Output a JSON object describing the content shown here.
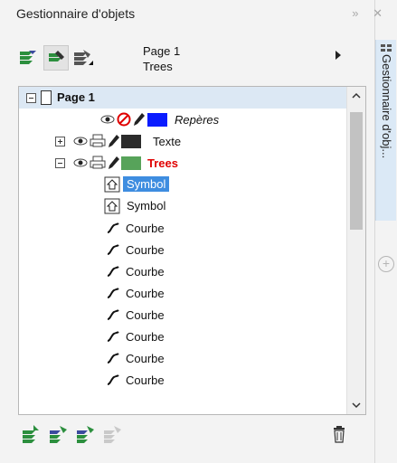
{
  "window": {
    "title": "Gestionnaire d'objets"
  },
  "titlebar_icons": {
    "collapse": "»",
    "close": "✕"
  },
  "toolbar": {
    "page_name": "Page 1",
    "layer_name": "Trees"
  },
  "tree": {
    "page": {
      "label": "Page 1"
    },
    "layers": [
      {
        "label": "Repères",
        "color": "#0a1cff"
      },
      {
        "label": "Texte",
        "color": "#2b2b2b"
      },
      {
        "label": "Trees",
        "color": "#57a35a",
        "label_color": "#e00000"
      }
    ],
    "symbols": [
      {
        "label": "Symbol",
        "selected": true
      },
      {
        "label": "Symbol",
        "selected": false
      }
    ],
    "curves": [
      "Courbe",
      "Courbe",
      "Courbe",
      "Courbe",
      "Courbe",
      "Courbe",
      "Courbe",
      "Courbe"
    ]
  },
  "side_tab": {
    "label": "Gestionnaire d'obj..."
  },
  "colors": {
    "accent": "#cde3f7",
    "selection": "#cfe5fb"
  }
}
